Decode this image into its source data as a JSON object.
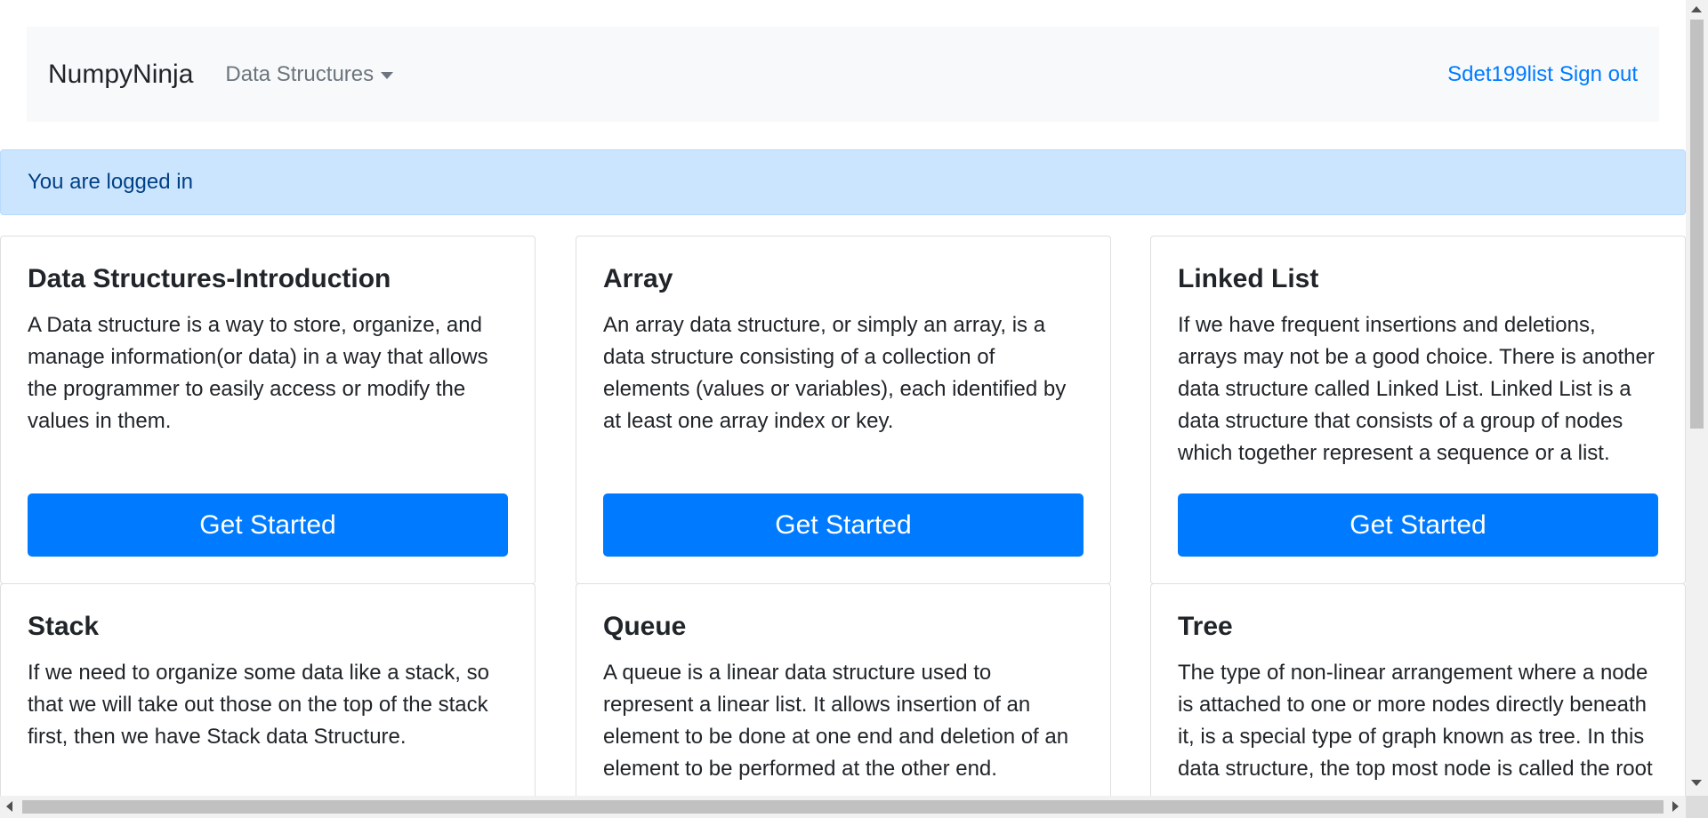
{
  "navbar": {
    "brand": "NumpyNinja",
    "dropdown_label": "Data Structures",
    "user": "Sdet199list",
    "signout": "Sign out"
  },
  "alert": {
    "message": "You are logged in"
  },
  "cards": [
    {
      "title": "Data Structures-Introduction",
      "text": "A Data structure is a way to store, organize, and manage information(or data) in a way that allows the programmer to easily access or modify the values in them.",
      "button": "Get Started"
    },
    {
      "title": "Array",
      "text": "An array data structure, or simply an array, is a data structure consisting of a collection of elements (values or variables), each identified by at least one array index or key.",
      "button": "Get Started"
    },
    {
      "title": "Linked List",
      "text": "If we have frequent insertions and deletions, arrays may not be a good choice. There is another data structure called Linked List. Linked List is a data structure that consists of a group of nodes which together represent a sequence or a list.",
      "button": "Get Started"
    },
    {
      "title": "Stack",
      "text": "If we need to organize some data like a stack, so that we will take out those on the top of the stack first, then we have Stack data Structure."
    },
    {
      "title": "Queue",
      "text": "A queue is a linear data structure used to represent a linear list. It allows insertion of an element to be done at one end and deletion of an element to be performed at the other end."
    },
    {
      "title": "Tree",
      "text": "The type of non-linear arrangement where a node is attached to one or more nodes directly beneath it, is a special type of graph known as tree. In this data structure, the top most node is called the root"
    }
  ],
  "colors": {
    "primary": "#007bff",
    "navbar_bg": "#f8f9fa",
    "alert_bg": "#cce5ff",
    "alert_text": "#004085"
  }
}
